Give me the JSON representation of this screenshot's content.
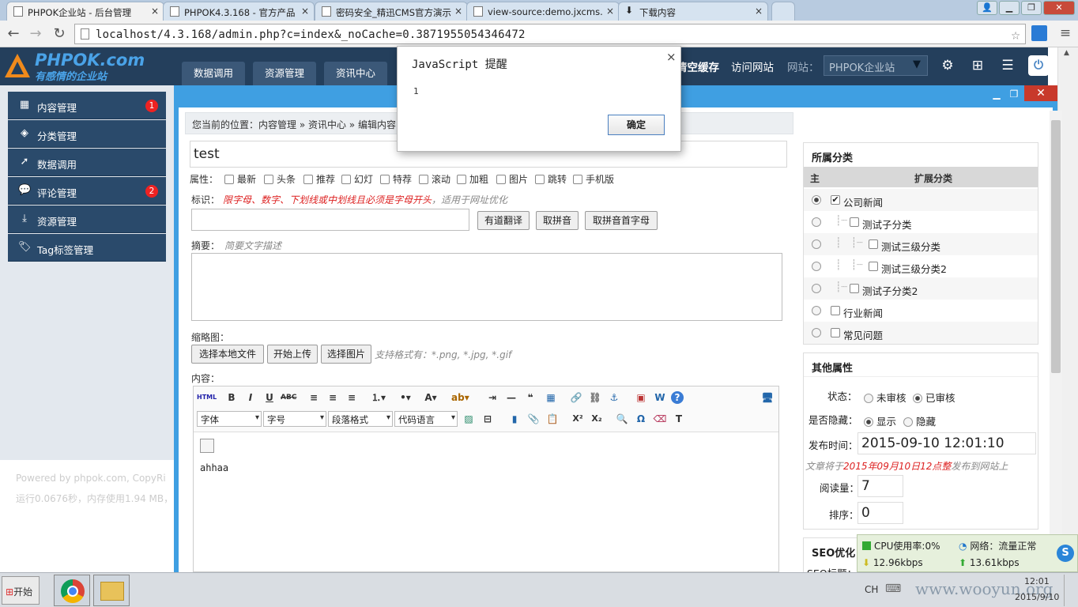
{
  "browser": {
    "tabs": [
      {
        "title": "PHPOK企业站 - 后台管理"
      },
      {
        "title": "PHPOK4.3.168 - 官方产品"
      },
      {
        "title": "密码安全_精迅CMS官方演示"
      },
      {
        "title": "view-source:demo.jxcms."
      },
      {
        "title": "下载内容"
      }
    ],
    "url": "localhost/4.3.168/admin.php?c=index&_noCache=0.3871955054346472"
  },
  "header": {
    "logo_text": "PHPOK.com",
    "logo_sub": "有感情的企业站",
    "nav": [
      "数据调用",
      "资源管理",
      "资讯中心"
    ],
    "clear_cache": "清空缓存",
    "visit_site": "访问网站",
    "site_label": "网站：",
    "site_value": "PHPOK企业站"
  },
  "sidebar": {
    "items": [
      {
        "label": "内容管理",
        "badge": "1"
      },
      {
        "label": "分类管理"
      },
      {
        "label": "数据调用"
      },
      {
        "label": "评论管理",
        "badge": "2"
      },
      {
        "label": "资源管理"
      },
      {
        "label": "Tag标签管理"
      }
    ],
    "footer_line1": "Powered by phpok.com, CopyRi",
    "footer_line2": "运行0.0676秒，内存使用1.94 MB，"
  },
  "form": {
    "breadcrumb": "您当前的位置：内容管理 » 资讯中心 » 编辑内容",
    "title_value": "test",
    "attr_label": "属性：",
    "attrs": [
      "最新",
      "头条",
      "推荐",
      "幻灯",
      "特荐",
      "滚动",
      "加粗",
      "图片",
      "跳转",
      "手机版"
    ],
    "identifier_label": "标识：",
    "identifier_hint_red": "限字母、数字、下划线或中划线且必须是字母开头",
    "identifier_hint_gray": "，适用于网址优化",
    "btn_youdao": "有道翻译",
    "btn_pinyin": "取拼音",
    "btn_pinyin_first": "取拼音首字母",
    "summary_label": "摘要：",
    "summary_hint": "简要文字描述",
    "thumb_label": "缩略图：",
    "btn_choose_local": "选择本地文件",
    "btn_upload": "开始上传",
    "btn_choose_image": "选择图片",
    "thumb_hint": "支持格式有：*.png, *.jpg, *.gif",
    "content_label": "内容：",
    "editor": {
      "font": "字体",
      "size": "字号",
      "para": "段落格式",
      "code": "代码语言",
      "body_text": "ahhaa"
    }
  },
  "category_panel": {
    "title": "所属分类",
    "col_main": "主",
    "col_ext": "扩展分类",
    "rows": [
      {
        "label": "公司新闻",
        "checked": true,
        "main": true
      },
      {
        "label": "测试子分类"
      },
      {
        "label": "测试三级分类"
      },
      {
        "label": "测试三级分类2"
      },
      {
        "label": "测试子分类2"
      },
      {
        "label": "行业新闻"
      },
      {
        "label": "常见问题"
      }
    ]
  },
  "other_panel": {
    "title": "其他属性",
    "status_label": "状态：",
    "status_off": "未审核",
    "status_on": "已审核",
    "hidden_label": "是否隐藏：",
    "show": "显示",
    "hide": "隐藏",
    "pubtime_label": "发布时间：",
    "pubtime_value": "2015-09-10 12:01:10",
    "pub_note_1": "文章将于",
    "pub_note_red": "2015年09月10日12点整",
    "pub_note_2": "发布到网站上",
    "views_label": "阅读量：",
    "views_value": "7",
    "sort_label": "排序：",
    "sort_value": "0"
  },
  "seo_panel": {
    "title": "SEO优化",
    "seo_title_label": "SEO标题："
  },
  "dialog": {
    "title": "JavaScript 提醒",
    "message": "1",
    "ok": "确定",
    "close": "×"
  },
  "netwidget": {
    "cpu": "CPU使用率:0%",
    "net": "网络：流量正常",
    "down": "12.96kbps",
    "up": "13.61kbps"
  },
  "taskbar": {
    "start": "开始",
    "lang": "CH",
    "clock": "12:01",
    "date": "2015/9/10",
    "watermark": "www.wooyun.org"
  }
}
